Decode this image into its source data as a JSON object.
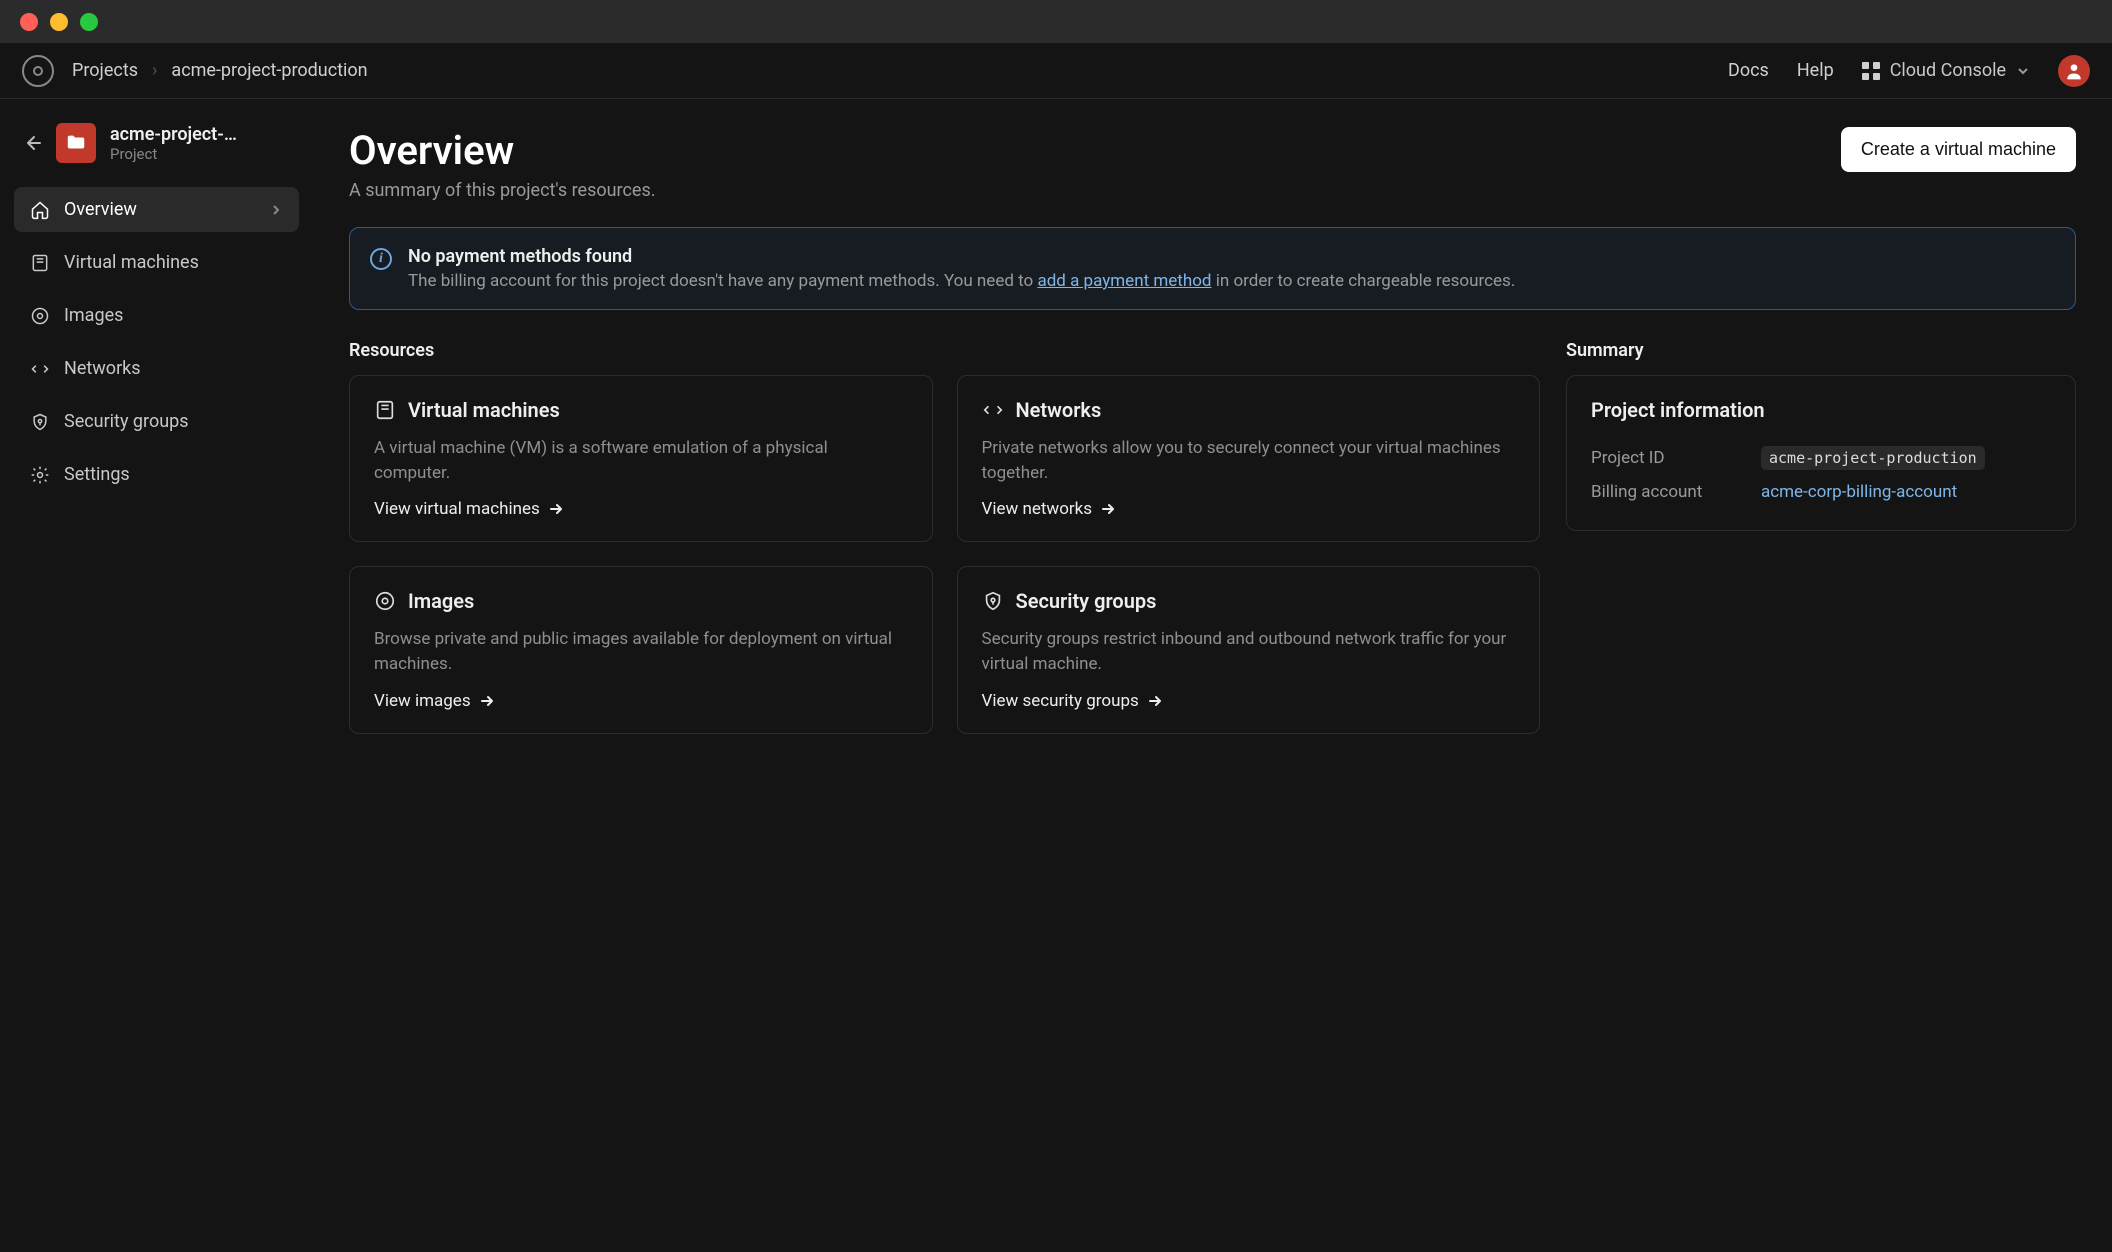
{
  "breadcrumb": {
    "root": "Projects",
    "current": "acme-project-production"
  },
  "topbar": {
    "docs": "Docs",
    "help": "Help",
    "console_switch": "Cloud Console"
  },
  "project_header": {
    "name": "acme-project-…",
    "type": "Project"
  },
  "sidebar": {
    "items": [
      {
        "label": "Overview"
      },
      {
        "label": "Virtual machines"
      },
      {
        "label": "Images"
      },
      {
        "label": "Networks"
      },
      {
        "label": "Security groups"
      },
      {
        "label": "Settings"
      }
    ]
  },
  "page": {
    "title": "Overview",
    "subtitle": "A summary of this project's resources.",
    "create_button": "Create a virtual machine"
  },
  "alert": {
    "title": "No payment methods found",
    "body_prefix": "The billing account for this project doesn't have any payment methods. You need to ",
    "link_text": "add a payment method",
    "body_suffix": " in order to create chargeable resources."
  },
  "sections": {
    "resources": "Resources",
    "summary": "Summary"
  },
  "cards": {
    "vm": {
      "title": "Virtual machines",
      "body": "A virtual machine (VM) is a software emulation of a physical computer.",
      "link": "View virtual machines"
    },
    "networks": {
      "title": "Networks",
      "body": "Private networks allow you to securely connect your virtual machines together.",
      "link": "View networks"
    },
    "images": {
      "title": "Images",
      "body": "Browse private and public images available for deployment on virtual machines.",
      "link": "View images"
    },
    "security": {
      "title": "Security groups",
      "body": "Security groups restrict inbound and outbound network traffic for your virtual machine.",
      "link": "View security groups"
    }
  },
  "summary_card": {
    "title": "Project information",
    "project_id_label": "Project ID",
    "project_id_value": "acme-project-production",
    "billing_label": "Billing account",
    "billing_value": "acme-corp-billing-account"
  }
}
